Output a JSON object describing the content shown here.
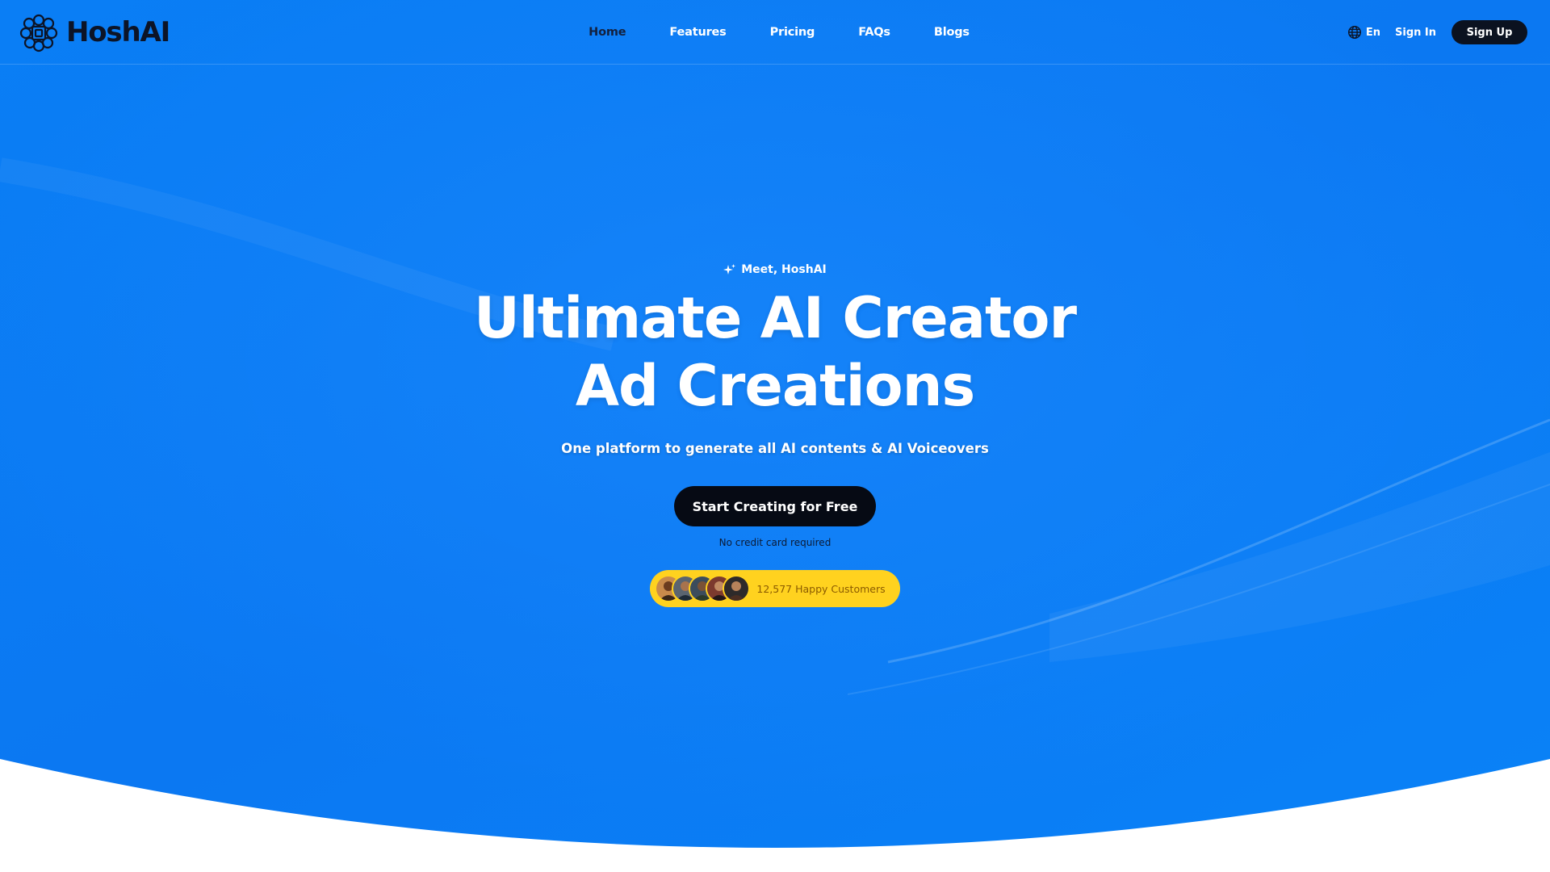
{
  "brand": {
    "name": "HoshAI",
    "icon": "brain-chip-icon"
  },
  "nav": {
    "items": [
      {
        "label": "Home",
        "active": true
      },
      {
        "label": "Features",
        "active": false
      },
      {
        "label": "Pricing",
        "active": false
      },
      {
        "label": "FAQs",
        "active": false
      },
      {
        "label": "Blogs",
        "active": false
      }
    ]
  },
  "header": {
    "language": {
      "label": "En",
      "icon": "globe-icon"
    },
    "sign_in": "Sign In",
    "sign_up": "Sign Up"
  },
  "hero": {
    "eyebrow": "Meet, HoshAI",
    "eyebrow_icon": "sparkle-icon",
    "headline_line1": "Ultimate AI Creator",
    "headline_line2": "Ad Creations",
    "subtitle": "One platform to generate all AI contents & AI Voiceovers",
    "cta": "Start Creating for Free",
    "note": "No credit card required",
    "social_proof": "12,577 Happy Customers"
  },
  "colors": {
    "hero_blue": "#0a7ef5",
    "hero_blue_dark": "#0567e6",
    "button_dark": "#060a14",
    "badge_yellow": "#ffd21f",
    "active_nav": "#13213f"
  }
}
